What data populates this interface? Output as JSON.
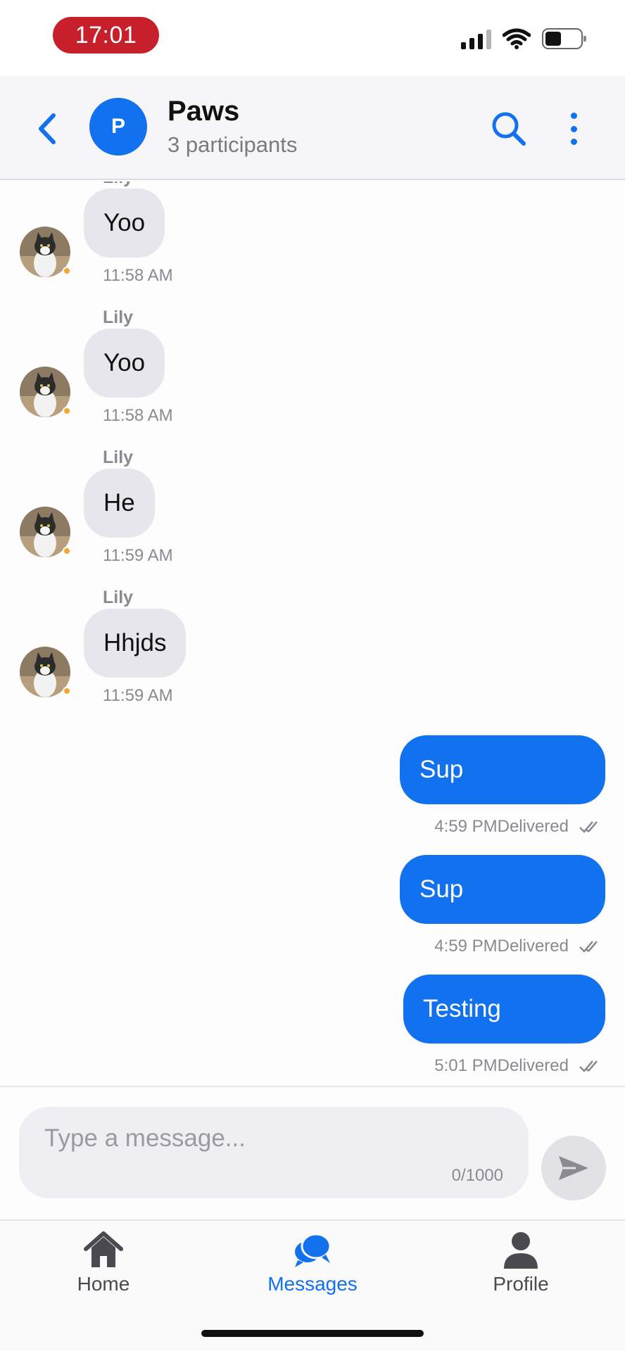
{
  "status_bar": {
    "time": "17:01"
  },
  "header": {
    "avatar_letter": "P",
    "title": "Paws",
    "subtitle": "3 participants"
  },
  "messages": {
    "incoming": [
      {
        "sender": "Lily",
        "text": "Yoo",
        "time": "11:58 AM"
      },
      {
        "sender": "Lily",
        "text": "Yoo",
        "time": "11:58 AM"
      },
      {
        "sender": "Lily",
        "text": "He",
        "time": "11:59 AM"
      },
      {
        "sender": "Lily",
        "text": "Hhjds",
        "time": "11:59 AM"
      }
    ],
    "outgoing": [
      {
        "text": "Sup",
        "time": "4:59 PM",
        "status": "Delivered"
      },
      {
        "text": "Sup",
        "time": "4:59 PM",
        "status": "Delivered"
      },
      {
        "text": "Testing",
        "time": "5:01 PM",
        "status": "Delivered"
      }
    ]
  },
  "composer": {
    "placeholder": "Type a message...",
    "value": "",
    "counter": "0/1000"
  },
  "tabbar": {
    "home": "Home",
    "messages": "Messages",
    "profile": "Profile"
  },
  "colors": {
    "accent": "#1271ee",
    "time_pill": "#c8202a",
    "incoming_bubble": "#e6e6ec",
    "online_dot": "#f4a72a"
  },
  "icons": [
    "back-chevron-icon",
    "search-icon",
    "more-vertical-icon",
    "send-icon",
    "home-icon",
    "messages-icon",
    "profile-icon",
    "double-check-icon"
  ]
}
